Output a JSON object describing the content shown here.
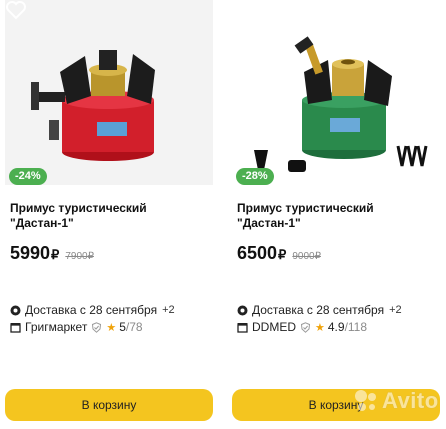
{
  "products": [
    {
      "discount": "-24%",
      "title": "Примус туристический \"Дастан-1\"",
      "price": "5990",
      "currency": "₽",
      "old_price": "7900₽",
      "delivery": "Доставка с 28 сентября",
      "delivery_more": "+2",
      "seller": "Григмаркет",
      "rating": "5",
      "reviews": "/78",
      "cart_label": "В корзину",
      "badge_color": "#4caf50"
    },
    {
      "discount": "-28%",
      "title": "Примус туристический \"Дастан-1\"",
      "price": "6500",
      "currency": "₽",
      "old_price": "9000₽",
      "delivery": "Доставка с 28 сентября",
      "delivery_more": "+2",
      "seller": "DDMED",
      "rating": "4.9",
      "reviews": "/118",
      "cart_label": "В корзину",
      "badge_color": "#4caf50"
    }
  ],
  "watermark": "Avito",
  "colors": {
    "accent_button": "#f4c51f",
    "badge": "#4caf50"
  },
  "icons": [
    "heart-icon",
    "delivery-icon",
    "store-icon",
    "verified-icon",
    "star-icon",
    "avito-logo-icon"
  ]
}
